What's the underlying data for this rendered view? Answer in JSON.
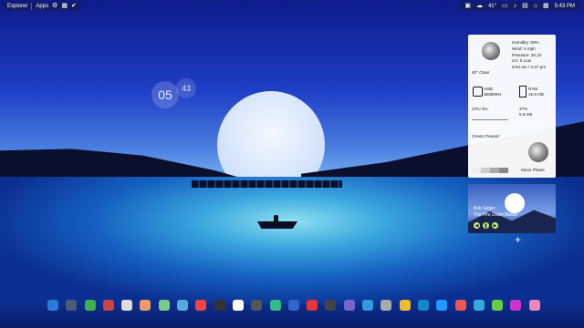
{
  "taskbar_left": {
    "explorer": "Explorer",
    "apps": "Apps"
  },
  "taskbar_right": {
    "temp": "41°",
    "time": "5:43 PM"
  },
  "clock": {
    "hour": "05",
    "minute": "43"
  },
  "weather": {
    "humidity": "Humidity: 60%",
    "wind": "Wind: 0 mph",
    "pressure": "Pressure: 30.22",
    "uv": "UV: 0 Low",
    "sun": "6:54 am / 4:47 pm",
    "temp_line": "40° Clear"
  },
  "system": {
    "cpu_name": "AMD",
    "cpu_freq": "3600MHz",
    "ram_label": "RAM",
    "ram_value": "15.9 GB",
    "cpu_label": "CPU 3%",
    "ram_pct": "37%",
    "ram_used": "5.8 GB"
  },
  "greeting": "Greetz Peeps!!",
  "moon_phase": "Moon Phase",
  "music": {
    "artist": "Bob Seger",
    "title": "The Fire Down Below"
  },
  "dock_colors": [
    "#2a7bd8",
    "#4b5b7a",
    "#3fb04f",
    "#c44",
    "#ddd",
    "#e96",
    "#7c8",
    "#5ad",
    "#e44",
    "#333",
    "#fff",
    "#555",
    "#3b8",
    "#36c",
    "#e33",
    "#444",
    "#76c",
    "#39d",
    "#aaa",
    "#eb3",
    "#18c",
    "#29f",
    "#e55",
    "#3ad",
    "#6c4",
    "#c3c",
    "#e8b"
  ]
}
